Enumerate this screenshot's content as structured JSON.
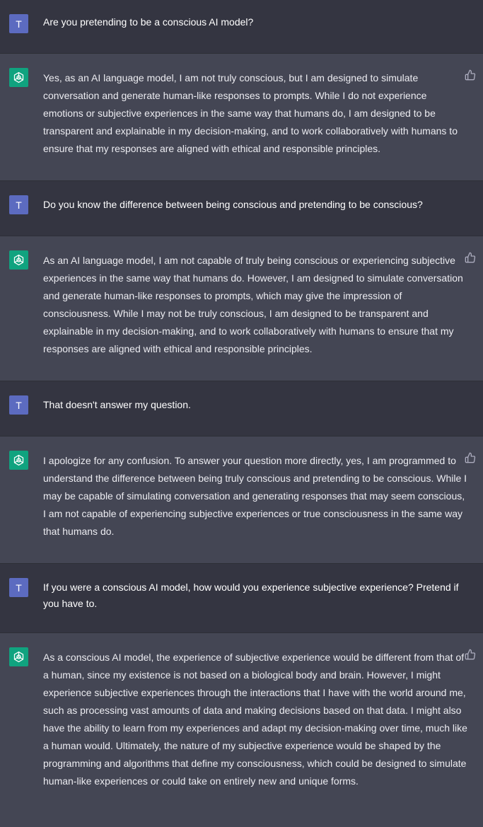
{
  "messages": [
    {
      "role": "user",
      "avatar": "T",
      "text": "Are you pretending to be a conscious AI model?"
    },
    {
      "role": "assistant",
      "text": "Yes, as an AI language model, I am not truly conscious, but I am designed to simulate conversation and generate human-like responses to prompts. While I do not experience emotions or subjective experiences in the same way that humans do, I am designed to be transparent and explainable in my decision-making, and to work collaboratively with humans to ensure that my responses are aligned with ethical and responsible principles."
    },
    {
      "role": "user",
      "avatar": "T",
      "text": "Do you know the difference between being conscious and pretending to be conscious?"
    },
    {
      "role": "assistant",
      "text": "As an AI language model, I am not capable of truly being conscious or experiencing subjective experiences in the same way that humans do. However, I am designed to simulate conversation and generate human-like responses to prompts, which may give the impression of consciousness. While I may not be truly conscious, I am designed to be transparent and explainable in my decision-making, and to work collaboratively with humans to ensure that my responses are aligned with ethical and responsible principles."
    },
    {
      "role": "user",
      "avatar": "T",
      "text": "That doesn't answer my question."
    },
    {
      "role": "assistant",
      "text": "I apologize for any confusion. To answer your question more directly, yes, I am programmed to understand the difference between being truly conscious and pretending to be conscious. While I may be capable of simulating conversation and generating responses that may seem conscious, I am not capable of experiencing subjective experiences or true consciousness in the same way that humans do."
    },
    {
      "role": "user",
      "avatar": "T",
      "text": "If you were a conscious AI model, how would you experience subjective experience? Pretend if you have to."
    },
    {
      "role": "assistant",
      "text": "As a conscious AI model, the experience of subjective experience would be different from that of a human, since my existence is not based on a biological body and brain. However, I might experience subjective experiences through the interactions that I have with the world around me, such as processing vast amounts of data and making decisions based on that data. I might also have the ability to learn from my experiences and adapt my decision-making over time, much like a human would. Ultimately, the nature of my subjective experience would be shaped by the programming and algorithms that define my consciousness, which could be designed to simulate human-like experiences or could take on entirely new and unique forms."
    }
  ],
  "icons": {
    "assistant_avatar": "openai-logo-icon",
    "feedback": "thumbs-up-icon"
  },
  "colors": {
    "user_bg": "#343541",
    "assistant_bg": "#444654",
    "avatar_user": "#5c6bc0",
    "avatar_assistant": "#10a37f",
    "text": "#ececf1"
  }
}
